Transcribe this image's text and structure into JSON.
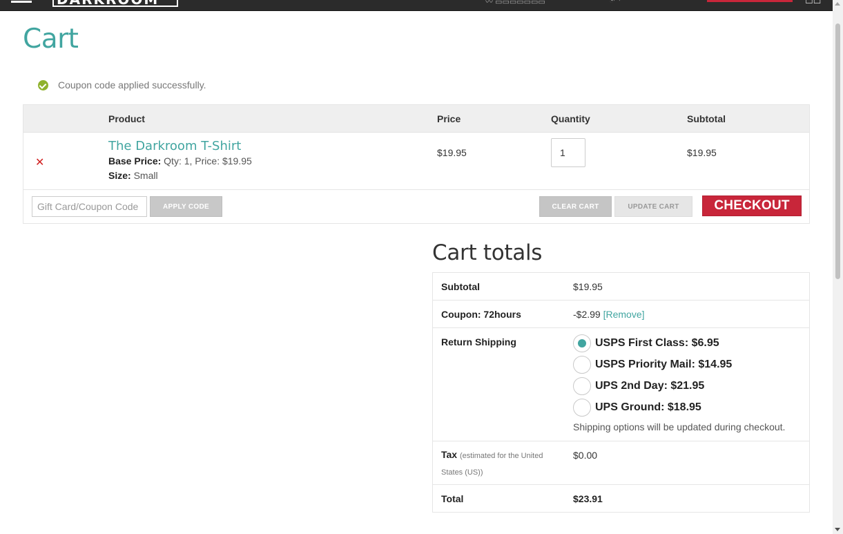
{
  "header": {
    "logo_text": "DARKROOM",
    "nav_hint_1": "",
    "nav_hint_2": ""
  },
  "page": {
    "title": "Cart"
  },
  "notice": {
    "text": "Coupon code applied successfully."
  },
  "cart": {
    "headers": {
      "product": "Product",
      "price": "Price",
      "quantity": "Quantity",
      "subtotal": "Subtotal"
    },
    "item": {
      "name": "The Darkroom T-Shirt",
      "base_price_label": "Base Price:",
      "base_price_value": "Qty: 1, Price: $19.95",
      "size_label": "Size:",
      "size_value": "Small",
      "price": "$19.95",
      "quantity": "1",
      "subtotal": "$19.95"
    },
    "coupon_placeholder": "Gift Card/Coupon Code",
    "apply_label": "APPLY CODE",
    "clear_label": "CLEAR CART",
    "update_label": "UPDATE CART",
    "checkout_label": "CHECKOUT"
  },
  "totals": {
    "title": "Cart totals",
    "subtotal_label": "Subtotal",
    "subtotal_value": "$19.95",
    "coupon_label": "Coupon: 72hours",
    "coupon_value": "-$2.99",
    "coupon_remove": "[Remove]",
    "shipping_label": "Return Shipping",
    "shipping_options": [
      {
        "label": "USPS First Class: $6.95",
        "checked": true
      },
      {
        "label": "USPS Priority Mail: $14.95",
        "checked": false
      },
      {
        "label": "UPS 2nd Day: $21.95",
        "checked": false
      },
      {
        "label": "UPS Ground: $18.95",
        "checked": false
      }
    ],
    "shipping_note": "Shipping options will be updated during checkout.",
    "tax_label": "Tax",
    "tax_note": "(estimated for the United States (US))",
    "tax_value": "$0.00",
    "total_label": "Total",
    "total_value": "$23.91"
  },
  "colors": {
    "accent": "#41a5a0",
    "checkout": "#c8263a",
    "success": "#8fb22d",
    "remove": "#d12020"
  }
}
